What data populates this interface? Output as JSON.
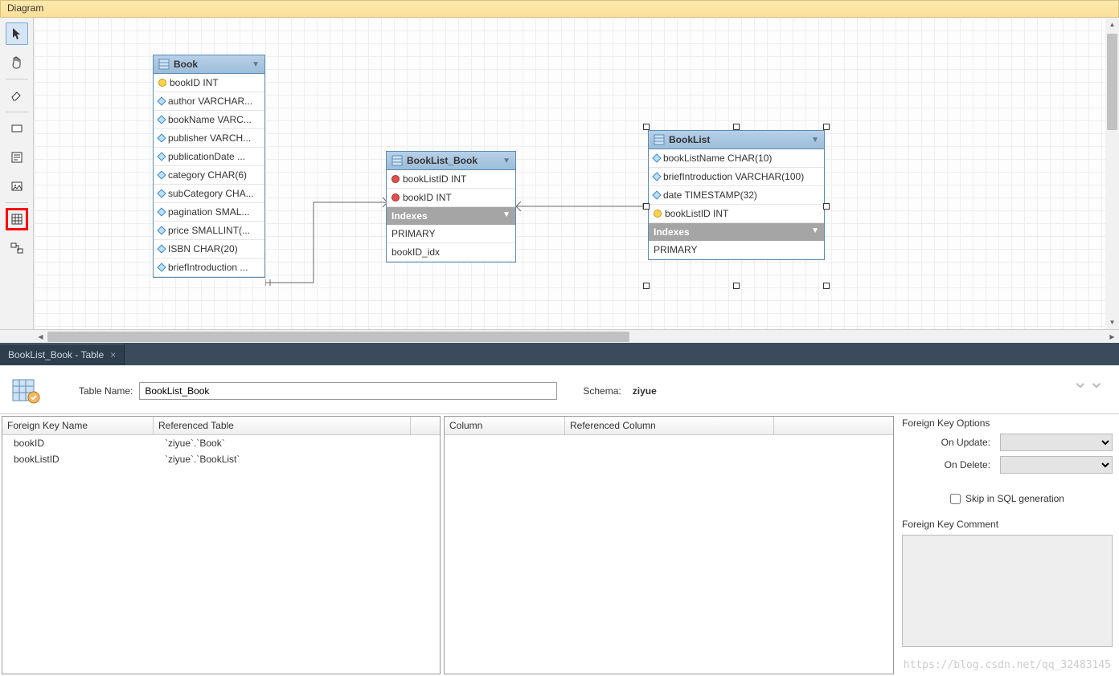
{
  "header": {
    "title": "Diagram"
  },
  "toolbar": {
    "tools": [
      "pointer",
      "hand",
      "eraser",
      "layer",
      "note",
      "image",
      "table",
      "relation"
    ]
  },
  "entities": {
    "book": {
      "title": "Book",
      "cols": [
        {
          "icon": "pk",
          "label": "bookID INT"
        },
        {
          "icon": "col",
          "label": "author VARCHAR..."
        },
        {
          "icon": "col",
          "label": "bookName VARC..."
        },
        {
          "icon": "col",
          "label": "publisher VARCH..."
        },
        {
          "icon": "col",
          "label": "publicationDate ..."
        },
        {
          "icon": "col",
          "label": "category CHAR(6)"
        },
        {
          "icon": "col",
          "label": "subCategory CHA..."
        },
        {
          "icon": "col",
          "label": "pagination SMAL..."
        },
        {
          "icon": "col",
          "label": "price SMALLINT(..."
        },
        {
          "icon": "col",
          "label": "ISBN CHAR(20)"
        },
        {
          "icon": "col",
          "label": "briefIntroduction ..."
        }
      ]
    },
    "booklist_book": {
      "title": "BookList_Book",
      "cols": [
        {
          "icon": "fk",
          "label": "bookListID INT"
        },
        {
          "icon": "fk",
          "label": "bookID INT"
        }
      ],
      "indexesLabel": "Indexes",
      "indexes": [
        "PRIMARY",
        "bookID_idx"
      ]
    },
    "booklist": {
      "title": "BookList",
      "cols": [
        {
          "icon": "col",
          "label": "bookListName CHAR(10)"
        },
        {
          "icon": "col",
          "label": "briefIntroduction VARCHAR(100)"
        },
        {
          "icon": "col",
          "label": "date TIMESTAMP(32)"
        },
        {
          "icon": "pk",
          "label": "bookListID INT"
        }
      ],
      "indexesLabel": "Indexes",
      "indexes": [
        "PRIMARY"
      ]
    }
  },
  "tab": {
    "label": "BookList_Book - Table"
  },
  "form": {
    "tableNameLabel": "Table Name:",
    "tableName": "BookList_Book",
    "schemaLabel": "Schema:",
    "schemaValue": "ziyue"
  },
  "fkGrid": {
    "headers": {
      "a": "Foreign Key Name",
      "b": "Referenced Table"
    },
    "rows": [
      {
        "name": "bookID",
        "ref": "`ziyue`.`Book`"
      },
      {
        "name": "bookListID",
        "ref": "`ziyue`.`BookList`"
      }
    ]
  },
  "colGrid": {
    "headers": {
      "a": "Column",
      "b": "Referenced Column"
    }
  },
  "fkOpts": {
    "title": "Foreign Key Options",
    "onUpdate": "On Update:",
    "onDelete": "On Delete:",
    "skip": "Skip in SQL generation",
    "commentTitle": "Foreign Key Comment"
  },
  "watermark": "https://blog.csdn.net/qq_32483145"
}
